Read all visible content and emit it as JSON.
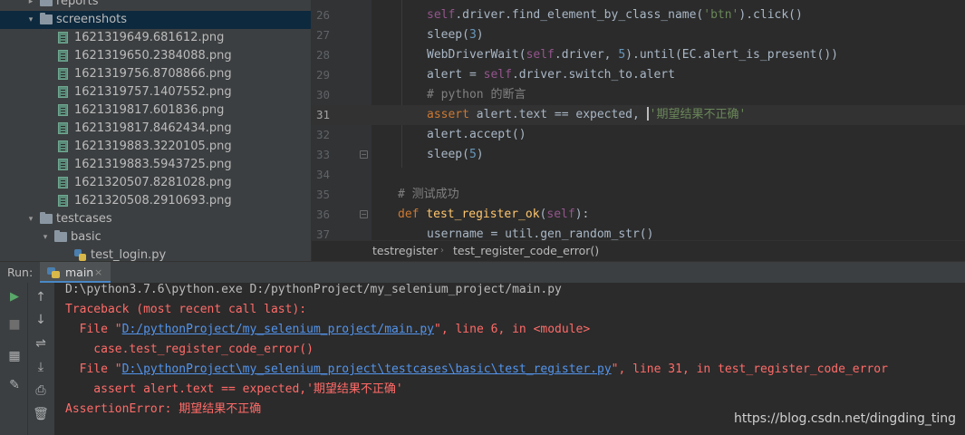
{
  "tree": {
    "rows": [
      {
        "label": "reports",
        "kind": "folder",
        "arrow": "▸",
        "level": 1
      },
      {
        "label": "screenshots",
        "kind": "folder",
        "arrow": "▾",
        "level": 1,
        "selected": true
      },
      {
        "label": "1621319649.681612.png",
        "kind": "image",
        "level": 2
      },
      {
        "label": "1621319650.2384088.png",
        "kind": "image",
        "level": 2
      },
      {
        "label": "1621319756.8708866.png",
        "kind": "image",
        "level": 2
      },
      {
        "label": "1621319757.1407552.png",
        "kind": "image",
        "level": 2
      },
      {
        "label": "1621319817.601836.png",
        "kind": "image",
        "level": 2
      },
      {
        "label": "1621319817.8462434.png",
        "kind": "image",
        "level": 2
      },
      {
        "label": "1621319883.3220105.png",
        "kind": "image",
        "level": 2
      },
      {
        "label": "1621319883.5943725.png",
        "kind": "image",
        "level": 2
      },
      {
        "label": "1621320507.8281028.png",
        "kind": "image",
        "level": 2
      },
      {
        "label": "1621320508.2910693.png",
        "kind": "image",
        "level": 2
      },
      {
        "label": "testcases",
        "kind": "folder",
        "arrow": "▾",
        "level": 1
      },
      {
        "label": "basic",
        "kind": "folder",
        "arrow": "▾",
        "level": 2
      },
      {
        "label": "test_login.py",
        "kind": "python",
        "level": 3
      }
    ]
  },
  "editor": {
    "current_line": "31",
    "lines": [
      {
        "n": "26",
        "parts": [
          [
            "self",
            "sf"
          ],
          [
            ".driver.find_element_by_class_name(",
            ""
          ],
          [
            "'btn'",
            "str"
          ],
          [
            ").click()",
            ""
          ]
        ]
      },
      {
        "n": "27",
        "parts": [
          [
            "sleep(",
            ""
          ],
          [
            "3",
            "num"
          ],
          [
            ")",
            ""
          ]
        ]
      },
      {
        "n": "28",
        "parts": [
          [
            "WebDriverWait(",
            ""
          ],
          [
            "self",
            "sf"
          ],
          [
            ".driver, ",
            ""
          ],
          [
            "5",
            "num"
          ],
          [
            ").until(EC.alert_is_present())",
            ""
          ]
        ]
      },
      {
        "n": "29",
        "parts": [
          [
            "alert = ",
            ""
          ],
          [
            "self",
            "sf"
          ],
          [
            ".driver.switch_to.alert",
            ""
          ]
        ]
      },
      {
        "n": "30",
        "parts": [
          [
            "# python 的断言",
            "cm"
          ]
        ]
      },
      {
        "n": "31",
        "parts": [
          [
            "assert ",
            "kw"
          ],
          [
            "alert.text == expected, ",
            ""
          ],
          [
            "|",
            "caret"
          ],
          [
            "'期望结果不正确'",
            "str"
          ]
        ]
      },
      {
        "n": "32",
        "parts": [
          [
            "alert.accept()",
            ""
          ]
        ]
      },
      {
        "n": "33",
        "parts": [
          [
            "sleep(",
            ""
          ],
          [
            "5",
            "num"
          ],
          [
            ")",
            ""
          ]
        ]
      },
      {
        "n": "34",
        "parts": []
      },
      {
        "n": "35",
        "parts": [
          [
            "# 测试成功",
            "cm"
          ]
        ]
      },
      {
        "n": "36",
        "parts": [
          [
            "def ",
            "kw"
          ],
          [
            "test_register_ok",
            "fnn"
          ],
          [
            "(",
            ""
          ],
          [
            "self",
            "sf"
          ],
          [
            "):",
            ""
          ]
        ]
      },
      {
        "n": "37",
        "parts": [
          [
            "username = util.gen_random_str()",
            ""
          ]
        ]
      }
    ]
  },
  "breadcrumb": {
    "items": [
      "testregister",
      "test_register_code_error()"
    ]
  },
  "run": {
    "label": "Run:",
    "tab_label": "main",
    "tab_close": "×"
  },
  "toolbar": {
    "buttons": [
      {
        "name": "rerun-icon",
        "glyph": "▶"
      },
      {
        "name": "scroll-up-icon",
        "glyph": "↑"
      },
      {
        "name": "stop-icon",
        "glyph": "■"
      },
      {
        "name": "scroll-down-icon",
        "glyph": "↓"
      },
      {
        "name": "layout-icon",
        "glyph": "▦"
      },
      {
        "name": "soft-wrap-icon",
        "glyph": "⇌"
      },
      {
        "name": "pin-icon",
        "glyph": "✎"
      },
      {
        "name": "scroll-to-end-icon",
        "glyph": "⤓"
      },
      {
        "name": "print-icon",
        "glyph": "⎙"
      },
      {
        "name": "trash-icon",
        "glyph": "🗑"
      }
    ]
  },
  "console": {
    "lines": [
      {
        "style": "plain",
        "parts": [
          [
            "D:\\python3.7.6\\python.exe D:/pythonProject/my_selenium_project/main.py",
            ""
          ]
        ]
      },
      {
        "style": "error",
        "parts": [
          [
            "Traceback (most recent call last):",
            ""
          ]
        ]
      },
      {
        "style": "error",
        "parts": [
          [
            "  File \"",
            ""
          ],
          [
            "D:/pythonProject/my_selenium_project/main.py",
            "link"
          ],
          [
            "\", line 6, in <module>",
            ""
          ]
        ]
      },
      {
        "style": "error",
        "parts": [
          [
            "    case.test_register_code_error()",
            ""
          ]
        ]
      },
      {
        "style": "error",
        "parts": [
          [
            "  File \"",
            ""
          ],
          [
            "D:\\pythonProject\\my_selenium_project\\testcases\\basic\\test_register.py",
            "link"
          ],
          [
            "\", line 31, in test_register_code_error",
            ""
          ]
        ]
      },
      {
        "style": "error",
        "parts": [
          [
            "    assert alert.text == expected,'期望结果不正确'",
            ""
          ]
        ]
      },
      {
        "style": "error",
        "parts": [
          [
            "AssertionError: 期望结果不正确",
            ""
          ]
        ]
      }
    ],
    "watermark": "https://blog.csdn.net/dingding_ting"
  },
  "colors": {
    "keyword": "#cc7832",
    "self": "#94558d",
    "string": "#6a8759",
    "number": "#6897bb",
    "comment": "#808080",
    "error_text": "#ff6b68",
    "link": "#5394ec",
    "selection": "#0d293e"
  }
}
